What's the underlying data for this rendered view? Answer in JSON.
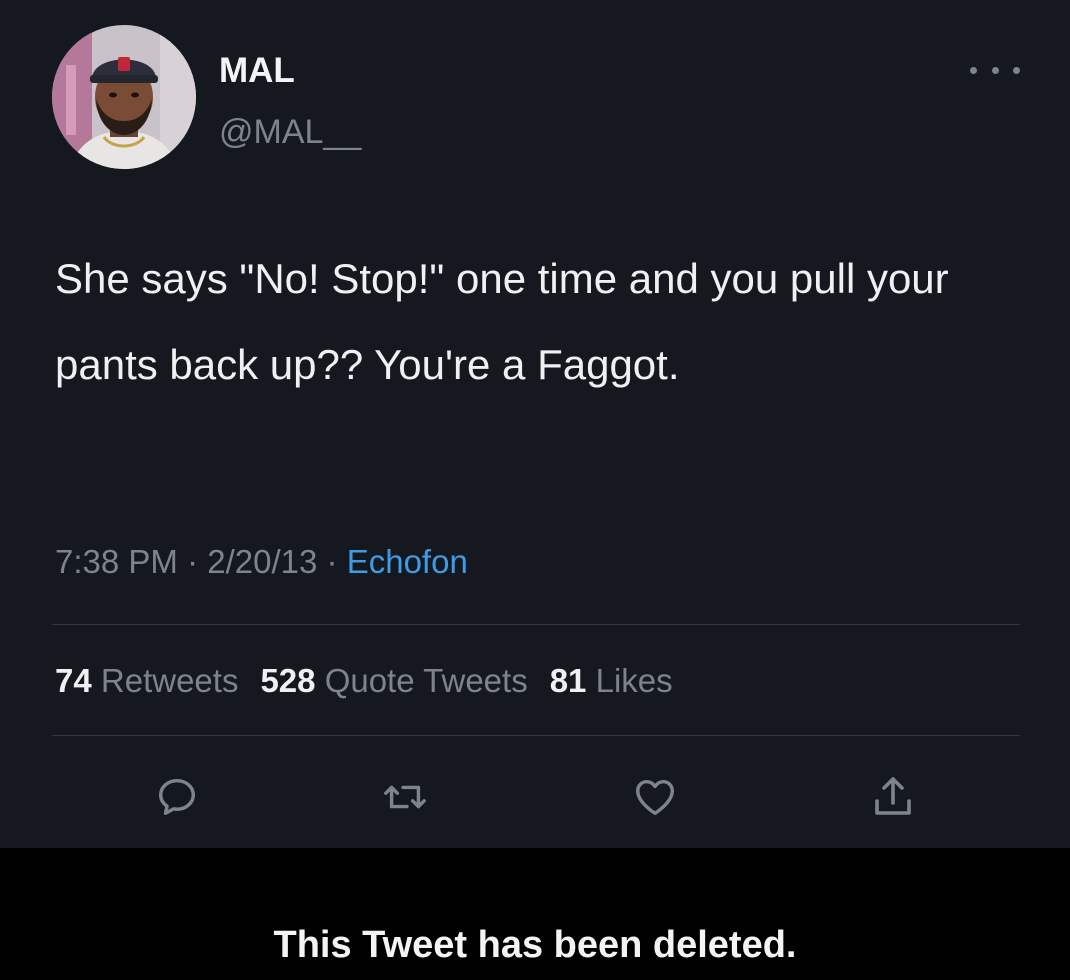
{
  "user": {
    "name": "MAL",
    "handle": "@MAL__"
  },
  "tweet": {
    "text": "She says \"No! Stop!\" one time and you pull your pants back up?? You're a Faggot.",
    "time": "7:38 PM",
    "date": "2/20/13",
    "source": "Echofon"
  },
  "stats": {
    "retweets_count": "74",
    "retweets_label": "Retweets",
    "quotes_count": "528",
    "quotes_label": "Quote Tweets",
    "likes_count": "81",
    "likes_label": "Likes"
  },
  "actions": {
    "reply_icon": "reply-icon",
    "retweet_icon": "retweet-icon",
    "like_icon": "heart-icon",
    "share_icon": "share-icon"
  },
  "notice": {
    "text": "This Tweet has been deleted."
  },
  "colors": {
    "background": "#15181f",
    "link": "#3e9be6",
    "muted": "#7d848c",
    "notice_bg": "#000000"
  }
}
